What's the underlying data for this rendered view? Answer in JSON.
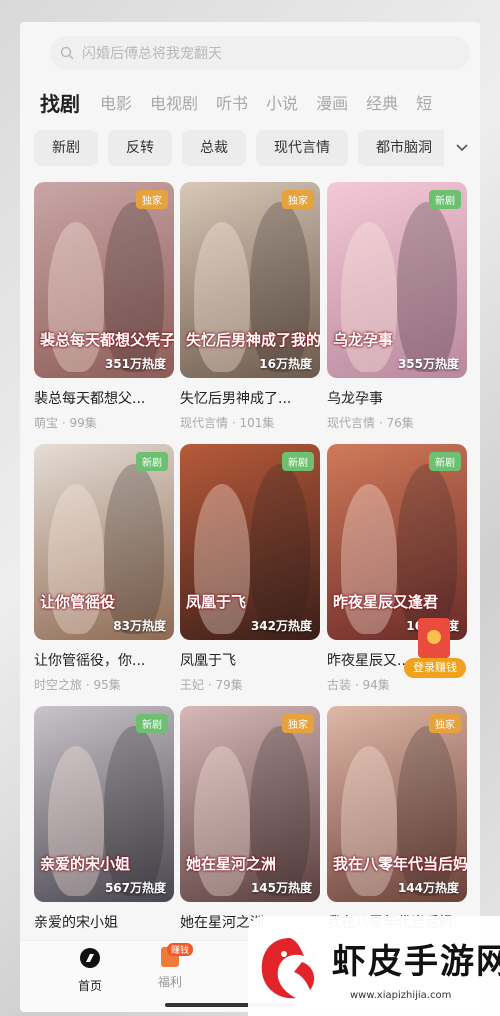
{
  "search": {
    "placeholder": "闪婚后傅总将我宠翻天"
  },
  "categories": [
    "找剧",
    "电影",
    "电视剧",
    "听书",
    "小说",
    "漫画",
    "经典",
    "短"
  ],
  "tags": [
    "新剧",
    "反转",
    "总裁",
    "现代言情",
    "都市脑洞"
  ],
  "cards": [
    {
      "title": "裴总每天都想父...",
      "meta": "萌宝 · 99集",
      "heat": "351万热度",
      "badge": "独家",
      "poster_text": "裴总每天都想父凭子贵",
      "c1": "#c9a6a6",
      "c2": "#8d5d58"
    },
    {
      "title": "失忆后男神成了...",
      "meta": "现代言情 · 101集",
      "heat": "16万热度",
      "badge": "独家",
      "poster_text": "失忆后男神成了我的",
      "c1": "#d8c8b8",
      "c2": "#6d5a4c"
    },
    {
      "title": "乌龙孕事",
      "meta": "现代言情 · 76集",
      "heat": "355万热度",
      "badge": "新剧",
      "poster_text": "乌龙孕事",
      "c1": "#f4c9d6",
      "c2": "#b9889e"
    },
    {
      "title": "让你管徭役，你...",
      "meta": "时空之旅 · 95集",
      "heat": "83万热度",
      "badge": "新剧",
      "poster_text": "让你管徭役",
      "c1": "#e5ddd6",
      "c2": "#8e6a52"
    },
    {
      "title": "凤凰于飞",
      "meta": "王妃 · 79集",
      "heat": "342万热度",
      "badge": "新剧",
      "poster_text": "凤凰于飞",
      "c1": "#b85a3a",
      "c2": "#3a1e18"
    },
    {
      "title": "昨夜星辰又...",
      "meta": "古装 · 94集",
      "heat": "16万热度",
      "badge": "新剧",
      "poster_text": "昨夜星辰又逢君",
      "c1": "#d07a5a",
      "c2": "#6a2a28"
    },
    {
      "title": "亲爱的宋小姐",
      "meta": "",
      "heat": "567万热度",
      "badge": "新剧",
      "poster_text": "亲爱的宋小姐",
      "c1": "#c8c4c8",
      "c2": "#4a4650"
    },
    {
      "title": "她在星河之洲",
      "meta": "",
      "heat": "145万热度",
      "badge": "独家",
      "poster_text": "她在星河之洲",
      "c1": "#d6b8b8",
      "c2": "#5a3e3e"
    },
    {
      "title": "我在八零年代当后妈",
      "meta": "",
      "heat": "144万热度",
      "badge": "独家",
      "poster_text": "我在八零年代当后妈",
      "c1": "#e0b8a8",
      "c2": "#6a4038"
    }
  ],
  "redpack": {
    "label": "登录赚钱"
  },
  "nav": {
    "home": "首页",
    "welfare": "福利",
    "welfare_badge": "赚钱"
  },
  "watermark": {
    "title": "虾皮手游网",
    "url": "www.xiapizhijia.com"
  },
  "colors": {
    "badge_exclusive": "#e6a23c",
    "badge_new": "#6cc070",
    "accent": "#e94b3c"
  }
}
